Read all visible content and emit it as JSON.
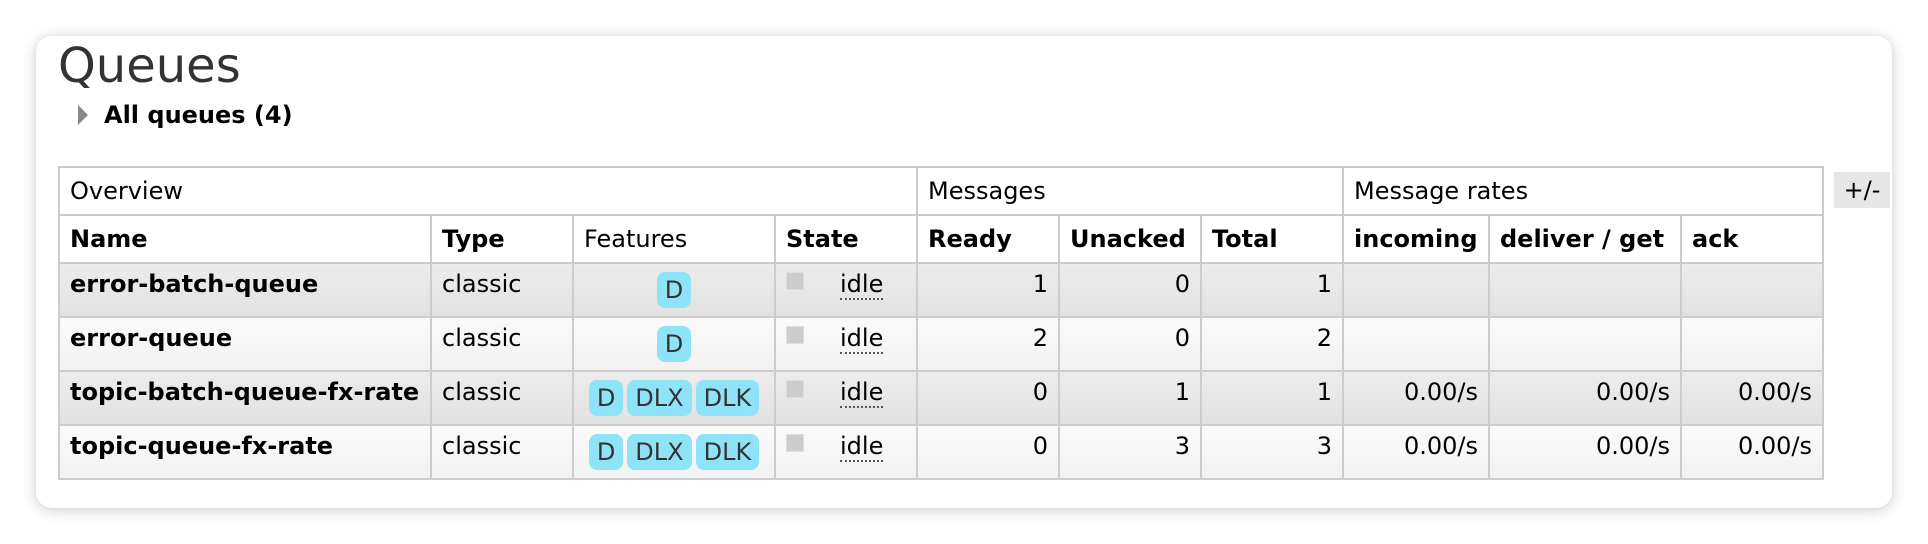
{
  "page": {
    "title": "Queues"
  },
  "section": {
    "label": "All queues (4)"
  },
  "table": {
    "groups": {
      "overview": "Overview",
      "messages": "Messages",
      "rates": "Message rates"
    },
    "columns": {
      "name": "Name",
      "type": "Type",
      "features": "Features",
      "state": "State",
      "ready": "Ready",
      "unacked": "Unacked",
      "total": "Total",
      "incoming": "incoming",
      "deliver": "deliver / get",
      "ack": "ack"
    },
    "toggle_columns": "+/-",
    "rows": [
      {
        "name": "error-batch-queue",
        "type": "classic",
        "features": [
          "D"
        ],
        "state": "idle",
        "ready": "1",
        "unacked": "0",
        "total": "1",
        "incoming": "",
        "deliver": "",
        "ack": ""
      },
      {
        "name": "error-queue",
        "type": "classic",
        "features": [
          "D"
        ],
        "state": "idle",
        "ready": "2",
        "unacked": "0",
        "total": "2",
        "incoming": "",
        "deliver": "",
        "ack": ""
      },
      {
        "name": "topic-batch-queue-fx-rate",
        "type": "classic",
        "features": [
          "D",
          "DLX",
          "DLK"
        ],
        "state": "idle",
        "ready": "0",
        "unacked": "1",
        "total": "1",
        "incoming": "0.00/s",
        "deliver": "0.00/s",
        "ack": "0.00/s"
      },
      {
        "name": "topic-queue-fx-rate",
        "type": "classic",
        "features": [
          "D",
          "DLX",
          "DLK"
        ],
        "state": "idle",
        "ready": "0",
        "unacked": "3",
        "total": "3",
        "incoming": "0.00/s",
        "deliver": "0.00/s",
        "ack": "0.00/s"
      }
    ]
  }
}
